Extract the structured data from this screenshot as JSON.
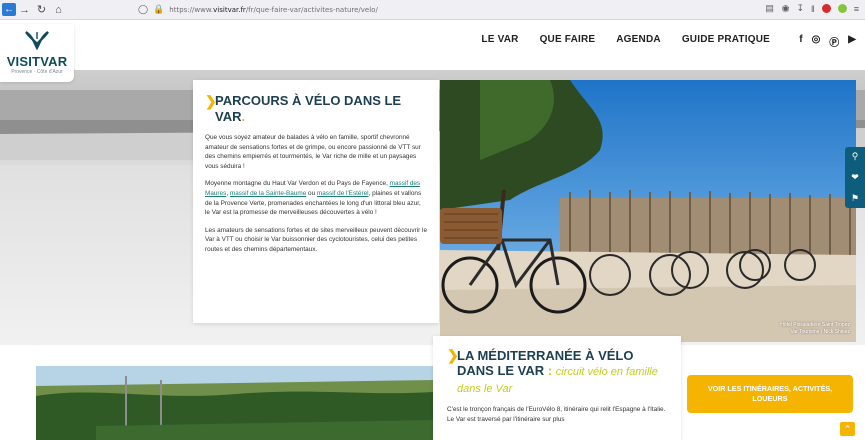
{
  "browser": {
    "url_prefix": "https://www.",
    "url_host": "visitvar.fr",
    "url_path": "/fr/que-faire-var/activites-nature/velo/",
    "back_icon": "arrow-left",
    "forward_icon": "arrow-right",
    "reload_icon": "reload",
    "home_icon": "home"
  },
  "header": {
    "logo_text_1": "VISIT",
    "logo_text_2": "VAR",
    "logo_subtitle": "Provence · Côte d'Azur",
    "nav": [
      "LE VAR",
      "QUE FAIRE",
      "AGENDA",
      "GUIDE PRATIQUE"
    ],
    "socials": [
      "facebook-icon",
      "instagram-icon",
      "pinterest-icon",
      "youtube-icon"
    ]
  },
  "section1": {
    "title_part": "PARCOURS À VÉLO DANS LE VAR",
    "title_dot": ".",
    "para1": "Que vous soyez amateur de balades à vélo en famille, sportif chevronné amateur de sensations fortes et de grimpe, ou encore passionné de VTT sur des chemins empierrés et tourmentés, le Var riche de mille et un paysages vous séduira !",
    "para2_a": "Moyenne montagne du Haut Var Verdon et du Pays de Fayence, ",
    "para2_link1": "massif des Maures",
    "para2_sep": ", ",
    "para2_link2": "massif de la Sainte-Baume",
    "para2_or": " ou ",
    "para2_link3": "massif de l'Estérel",
    "para2_b": ", plaines et vallons de la Provence Verte, promenades enchantées le long d'un littoral bleu azur, le Var est la promesse de merveilleuses découvertes à vélo !",
    "para3": "Les amateurs de sensations fortes et de sites merveilleux peuvent découvrir le Var à VTT ou choisir le Var buissonnier des cyclotouristes, celui des petites routes et des chemins départementaux.",
    "credit_line1": "Hôtel Pissaladière Saint Tropez",
    "credit_line2": "Var Tourisme / Nick Shinez"
  },
  "section2": {
    "title": "LA MÉDITERRANÉE À VÉLO DANS LE VAR",
    "title_colon": ":",
    "subtitle": "circuit vélo en famille dans le Var",
    "para": "C'est le tronçon français de l'EuroVélo 8, itinéraire qui relit l'Espagne à l'Italie. Le Var est traversé par l'itinéraire sur plus"
  },
  "cta_label": "VOIR LES ITINÉRAIRES, ACTIVITÉS, LOUEURS",
  "tools": [
    "search-icon",
    "heart-icon",
    "flag-icon"
  ],
  "colors": {
    "accent": "#f5b400",
    "brand": "#0f4b5b",
    "link": "#1a7f78",
    "tool_bg": "#0f5d7d"
  }
}
